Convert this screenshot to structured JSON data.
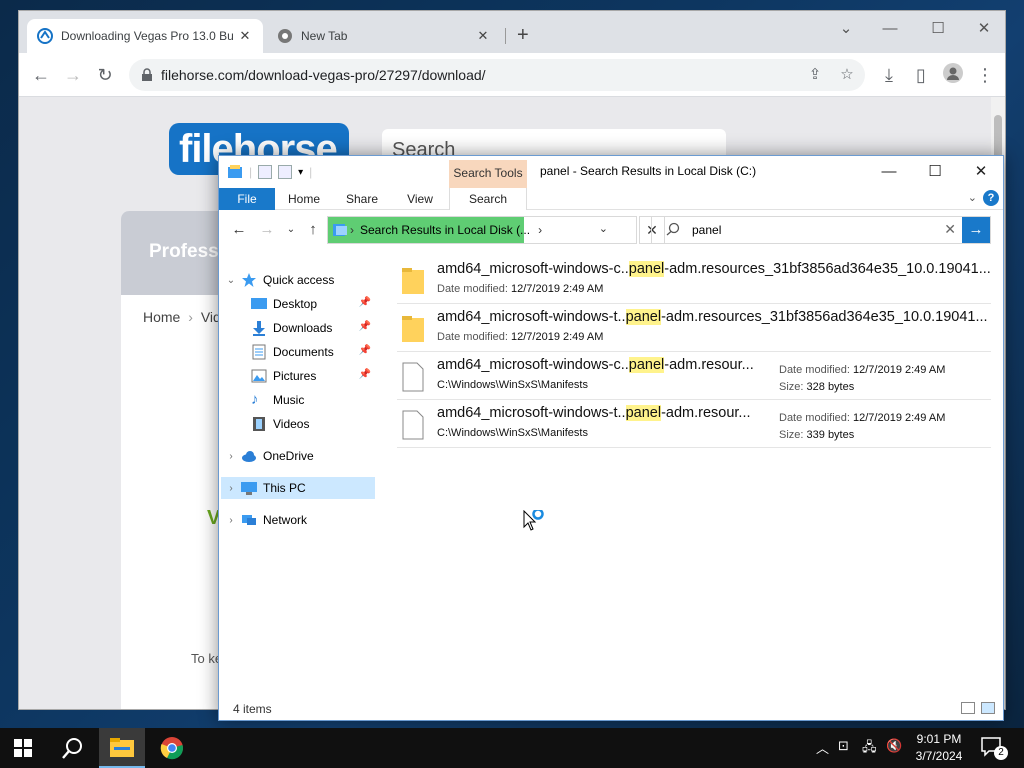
{
  "browser": {
    "tabs": [
      {
        "title": "Downloading Vegas Pro 13.0 Bu",
        "active": true
      },
      {
        "title": "New Tab",
        "active": false
      }
    ],
    "url": "filehorse.com/download-vegas-pro/27297/download/"
  },
  "webpage": {
    "logo": "filehorse",
    "search_placeholder": "Search",
    "card_heading": "Profess",
    "breadcrumb_home": "Home",
    "breadcrumb_sep": "›",
    "breadcrumb_next": "Vide",
    "green_text": "V",
    "body_text": "To ke"
  },
  "explorer": {
    "title": "panel - Search Results in Local Disk (C:)",
    "contextual_tab": "Search Tools",
    "ribbon_tabs": [
      "File",
      "Home",
      "Share",
      "View",
      "Search"
    ],
    "address": "Search Results in Local Disk (...",
    "search_value": "panel",
    "nav": {
      "quick_access": "Quick access",
      "desktop": "Desktop",
      "downloads": "Downloads",
      "documents": "Documents",
      "pictures": "Pictures",
      "music": "Music",
      "videos": "Videos",
      "onedrive": "OneDrive",
      "this_pc": "This PC",
      "network": "Network"
    },
    "files": [
      {
        "pre": "amd64_microsoft-windows-c..",
        "hl": "panel",
        "post": "-adm.resources_31bf3856ad364e35_10.0.19041...",
        "sub_label": "Date modified:",
        "sub_value": "12/7/2019 2:49 AM"
      },
      {
        "pre": "amd64_microsoft-windows-t..",
        "hl": "panel",
        "post": "-adm.resources_31bf3856ad364e35_10.0.19041...",
        "sub_label": "Date modified:",
        "sub_value": "12/7/2019 2:49 AM"
      },
      {
        "pre": "amd64_microsoft-windows-c..",
        "hl": "panel",
        "post": "-adm.resour...",
        "path": "C:\\Windows\\WinSxS\\Manifests",
        "date_label": "Date modified:",
        "date_value": "12/7/2019 2:49 AM",
        "size_label": "Size:",
        "size_value": "328 bytes"
      },
      {
        "pre": "amd64_microsoft-windows-t..",
        "hl": "panel",
        "post": "-adm.resour...",
        "path": "C:\\Windows\\WinSxS\\Manifests",
        "date_label": "Date modified:",
        "date_value": "12/7/2019 2:49 AM",
        "size_label": "Size:",
        "size_value": "339 bytes"
      }
    ],
    "status": "4 items"
  },
  "taskbar": {
    "time": "9:01 PM",
    "date": "3/7/2024",
    "notification_count": "2"
  },
  "colors": {
    "accent": "#1979ca",
    "address_fill": "#5fcd73",
    "highlight": "#fff38c",
    "search_tools": "#f8d7bd"
  }
}
